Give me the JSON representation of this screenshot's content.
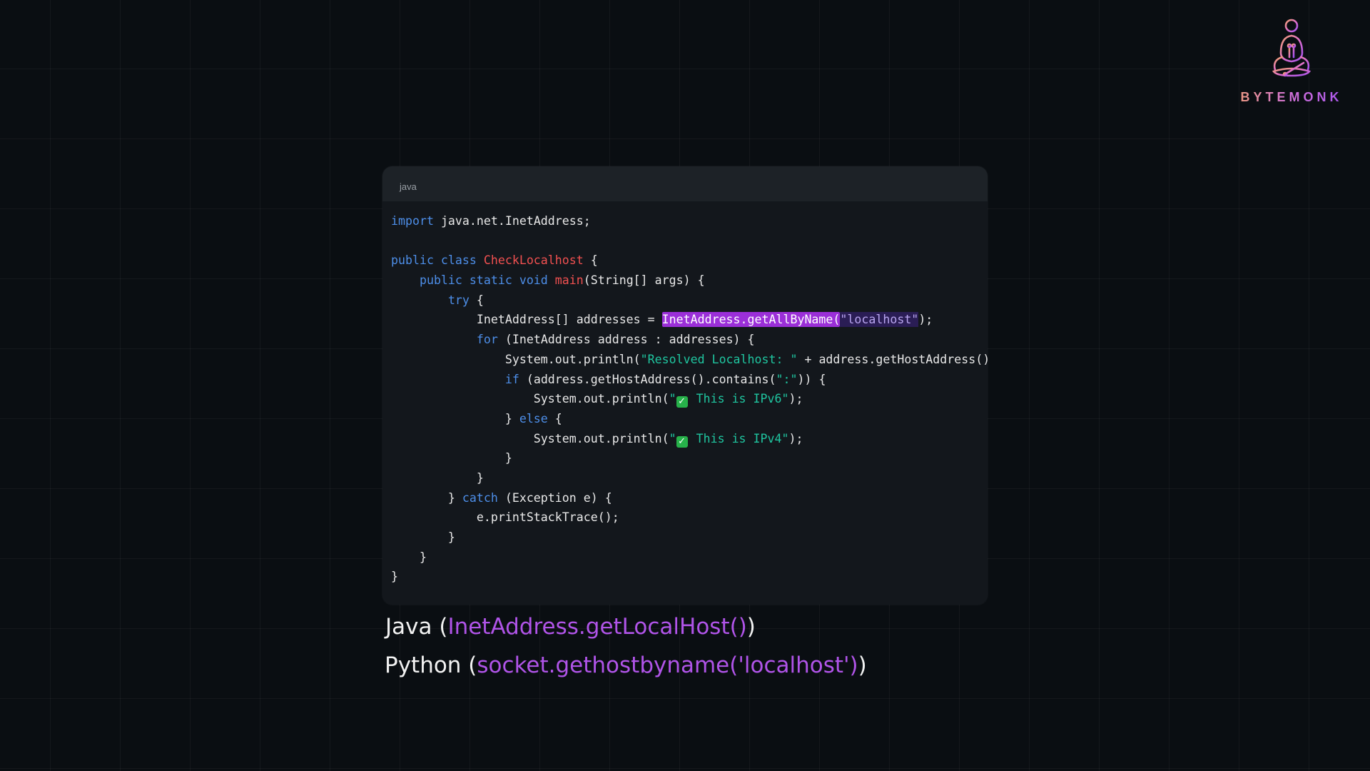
{
  "logo": {
    "text": "BYTEMONK",
    "icon": "meditating-monk-circuit-icon"
  },
  "code_block": {
    "language": "java",
    "lines": [
      [
        {
          "t": "import",
          "c": "kw"
        },
        {
          "t": " java.net.InetAddress;"
        }
      ],
      [],
      [
        {
          "t": "public class ",
          "c": "kw"
        },
        {
          "t": "CheckLocalhost",
          "c": "cls"
        },
        {
          "t": " {"
        }
      ],
      [
        {
          "t": "    public static void ",
          "c": "kw"
        },
        {
          "t": "main",
          "c": "cls"
        },
        {
          "t": "(String[] args) {"
        }
      ],
      [
        {
          "t": "        "
        },
        {
          "t": "try",
          "c": "kw"
        },
        {
          "t": " {"
        }
      ],
      [
        {
          "t": "            InetAddress[] addresses = "
        },
        {
          "t": "InetAddress.getAllByName(",
          "c": "hl"
        },
        {
          "t": "\"localhost\"",
          "c": "hlstr"
        },
        {
          "t": ");"
        }
      ],
      [
        {
          "t": "            "
        },
        {
          "t": "for",
          "c": "kw"
        },
        {
          "t": " (InetAddress address : addresses) {"
        }
      ],
      [
        {
          "t": "                System.out.println("
        },
        {
          "t": "\"Resolved Localhost: \"",
          "c": "str"
        },
        {
          "t": " + address.getHostAddress());"
        }
      ],
      [
        {
          "t": "                "
        },
        {
          "t": "if",
          "c": "kw"
        },
        {
          "t": " (address.getHostAddress().contains("
        },
        {
          "t": "\":\"",
          "c": "str"
        },
        {
          "t": ")) {"
        }
      ],
      [
        {
          "t": "                    System.out.println("
        },
        {
          "t": "\"",
          "c": "str"
        },
        {
          "t": "✓",
          "c": "check"
        },
        {
          "t": " This is IPv6\"",
          "c": "str"
        },
        {
          "t": ");"
        }
      ],
      [
        {
          "t": "                } "
        },
        {
          "t": "else",
          "c": "kw"
        },
        {
          "t": " {"
        }
      ],
      [
        {
          "t": "                    System.out.println("
        },
        {
          "t": "\"",
          "c": "str"
        },
        {
          "t": "✓",
          "c": "check"
        },
        {
          "t": " This is IPv4\"",
          "c": "str"
        },
        {
          "t": ");"
        }
      ],
      [
        {
          "t": "                }"
        }
      ],
      [
        {
          "t": "            }"
        }
      ],
      [
        {
          "t": "        } "
        },
        {
          "t": "catch",
          "c": "kw"
        },
        {
          "t": " (Exception e) {"
        }
      ],
      [
        {
          "t": "            e.printStackTrace();"
        }
      ],
      [
        {
          "t": "        }"
        }
      ],
      [
        {
          "t": "    }"
        }
      ],
      [
        {
          "t": "}"
        }
      ]
    ]
  },
  "captions": {
    "java": {
      "lang": "Java (",
      "call": "InetAddress.getLocalHost()",
      "close": ")"
    },
    "python": {
      "lang": "Python (",
      "call": "socket.gethostbyname('localhost')",
      "close": ")"
    }
  },
  "colors": {
    "background": "#0a0e12",
    "keyword": "#4d8ee8",
    "class_name": "#f05050",
    "string": "#1fc6a0",
    "highlight": "#9b2fd8",
    "caption_call": "#b054e8"
  }
}
